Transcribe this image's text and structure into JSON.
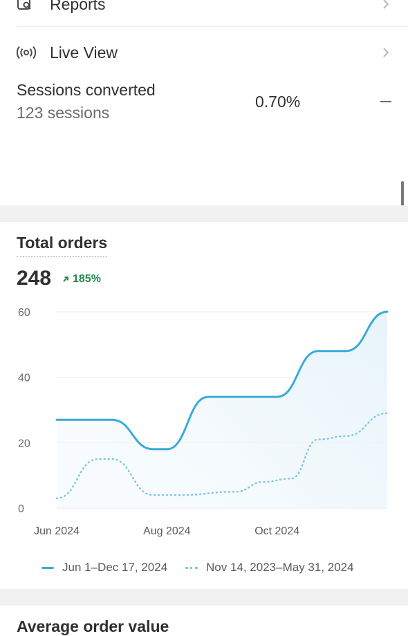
{
  "nav": {
    "reports_label": "Reports",
    "live_view_label": "Live View"
  },
  "sessions": {
    "title": "Sessions converted",
    "subtitle": "123 sessions",
    "rate": "0.70%"
  },
  "total_orders": {
    "title": "Total orders",
    "value": "248",
    "change": "185%",
    "change_color": "#1f8a4c"
  },
  "legend": {
    "current": "Jun 1–Dec 17, 2024",
    "previous": "Nov 14, 2023–May 31, 2024"
  },
  "next_card": {
    "title": "Average order value"
  },
  "chart_data": {
    "type": "line",
    "y_ticks": [
      "60",
      "40",
      "20",
      "0"
    ],
    "ylim": [
      0,
      60
    ],
    "x_tick_labels": [
      {
        "label": "Jun 2024",
        "x": 0
      },
      {
        "label": "Aug 2024",
        "x": 8
      },
      {
        "label": "Oct 2024",
        "x": 16
      }
    ],
    "xlim": [
      0,
      24
    ],
    "grid": true,
    "legend_position": "bottom",
    "series": [
      {
        "name": "Jun 1–Dec 17, 2024",
        "style": "solid",
        "color": "#3aaad8",
        "x": [
          0,
          4,
          7,
          8,
          11,
          16,
          19,
          21,
          24
        ],
        "values": [
          27,
          27,
          18,
          18,
          34,
          34,
          48,
          48,
          60
        ]
      },
      {
        "name": "Nov 14, 2023–May 31, 2024",
        "style": "dotted",
        "color": "#7fc8e6",
        "x": [
          0,
          3,
          4,
          7,
          9,
          13,
          15,
          17,
          19,
          21,
          24
        ],
        "values": [
          3,
          15,
          15,
          4,
          4,
          5,
          8,
          9,
          21,
          22,
          29
        ]
      }
    ]
  }
}
